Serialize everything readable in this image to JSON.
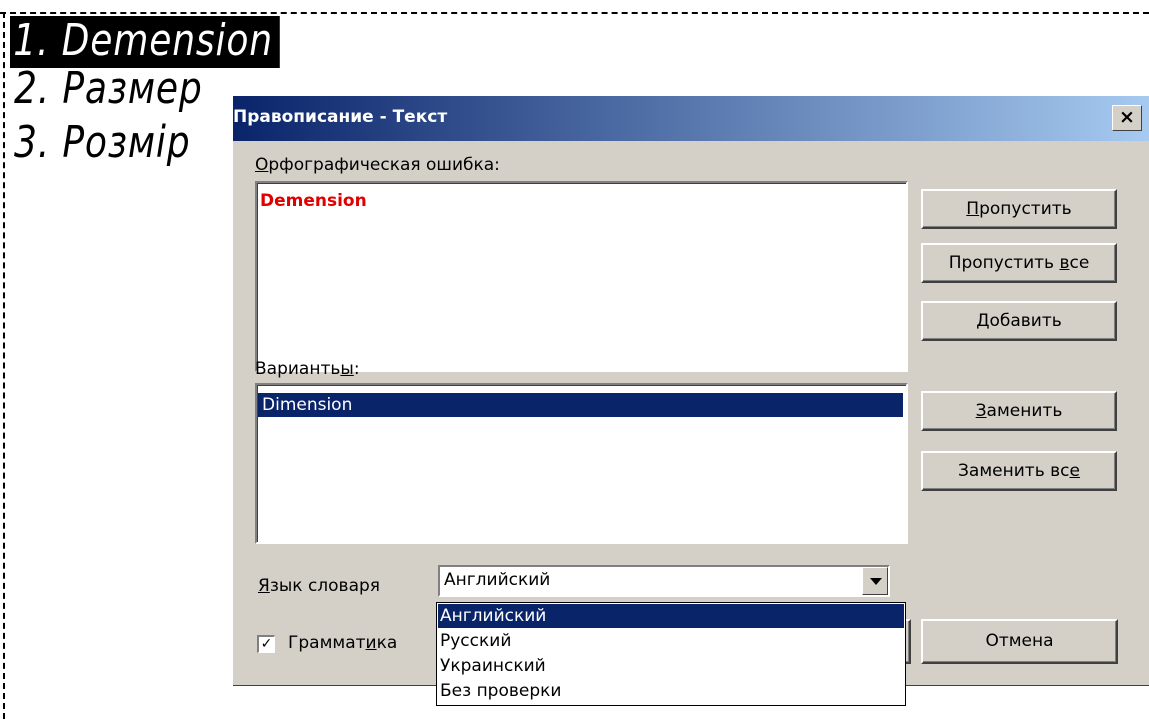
{
  "drawing": {
    "lines": [
      "1. Demension",
      "2. Размер",
      "3. Розмір"
    ]
  },
  "dialog": {
    "title": "Правописание - Текст",
    "close_glyph": "✕",
    "error_label_prefix": "О",
    "error_label_rest": "рфографическая ошибка:",
    "error_word": "Demension",
    "suggestions_label_prefix": "Варианть",
    "suggestions_label_ul": "ы",
    "suggestions_label_suffix": ":",
    "suggestions": [
      "Dimension"
    ],
    "buttons": {
      "ignore": {
        "ul": "П",
        "rest": "ропустить"
      },
      "ignore_all": {
        "pre": "Пропустить ",
        "ul": "в",
        "rest": "се"
      },
      "add": {
        "ul": "Д",
        "rest": "обавить"
      },
      "replace": {
        "ul": "З",
        "rest": "аменить"
      },
      "replace_all": {
        "pre": "Заменить вс",
        "ul": "е",
        "rest": ""
      },
      "cancel": "Отмена"
    },
    "language_label_ul": "Я",
    "language_label_rest": "зык словаря",
    "language_selected": "Английский",
    "language_options": [
      "Английский",
      "Русский",
      "Украинский",
      "Без проверки"
    ],
    "grammar_checked": true,
    "grammar_label_pre": "Граммат",
    "grammar_label_ul": "и",
    "grammar_label_rest": "ка"
  }
}
